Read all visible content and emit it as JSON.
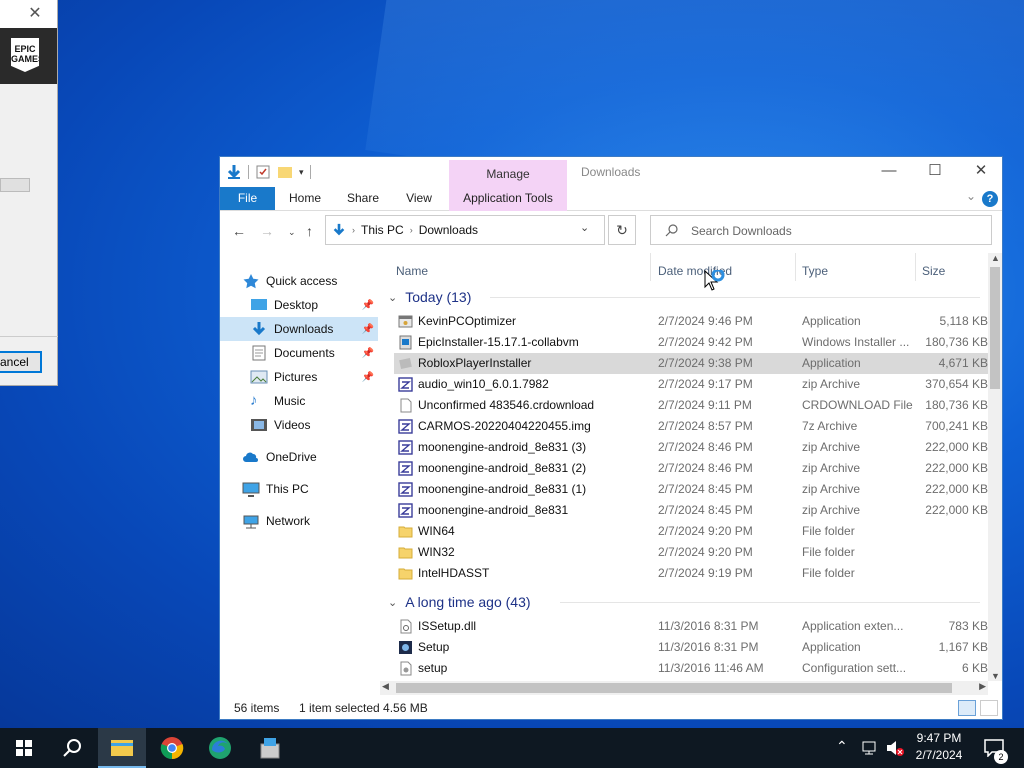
{
  "epic_dialog": {
    "cancel_label": "ancel",
    "logo_text": "EPIC\nGAMES"
  },
  "explorer": {
    "title": "Downloads",
    "context_tab": "Manage",
    "ribbon_tabs": [
      "File",
      "Home",
      "Share",
      "View",
      "Application Tools"
    ],
    "breadcrumb": [
      "This PC",
      "Downloads"
    ],
    "search_placeholder": "Search Downloads",
    "nav": [
      {
        "label": "Quick access",
        "icon": "star-icon"
      },
      {
        "label": "Desktop",
        "icon": "desktop-icon",
        "pinned": true
      },
      {
        "label": "Downloads",
        "icon": "downloads-icon",
        "pinned": true,
        "selected": true
      },
      {
        "label": "Documents",
        "icon": "documents-icon",
        "pinned": true
      },
      {
        "label": "Pictures",
        "icon": "pictures-icon",
        "pinned": true
      },
      {
        "label": "Music",
        "icon": "music-icon"
      },
      {
        "label": "Videos",
        "icon": "videos-icon"
      },
      {
        "label": "OneDrive",
        "icon": "cloud-icon"
      },
      {
        "label": "This PC",
        "icon": "computer-icon"
      },
      {
        "label": "Network",
        "icon": "network-icon"
      }
    ],
    "columns": [
      "Name",
      "Date modified",
      "Type",
      "Size"
    ],
    "groups": [
      {
        "label": "Today (13)",
        "files": [
          {
            "name": "KevinPCOptimizer",
            "date": "2/7/2024 9:46 PM",
            "type": "Application",
            "size": "5,118 KB",
            "icon": "app"
          },
          {
            "name": "EpicInstaller-15.17.1-collabvm",
            "date": "2/7/2024 9:42 PM",
            "type": "Windows Installer ...",
            "size": "180,736 KB",
            "icon": "msi"
          },
          {
            "name": "RobloxPlayerInstaller",
            "date": "2/7/2024 9:38 PM",
            "type": "Application",
            "size": "4,671 KB",
            "icon": "roblox",
            "selected": true
          },
          {
            "name": "audio_win10_6.0.1.7982",
            "date": "2/7/2024 9:17 PM",
            "type": "zip Archive",
            "size": "370,654 KB",
            "icon": "zip"
          },
          {
            "name": "Unconfirmed 483546.crdownload",
            "date": "2/7/2024 9:11 PM",
            "type": "CRDOWNLOAD File",
            "size": "180,736 KB",
            "icon": "blank"
          },
          {
            "name": "CARMOS-20220404220455.img",
            "date": "2/7/2024 8:57 PM",
            "type": "7z Archive",
            "size": "700,241 KB",
            "icon": "zip"
          },
          {
            "name": "moonengine-android_8e831 (3)",
            "date": "2/7/2024 8:46 PM",
            "type": "zip Archive",
            "size": "222,000 KB",
            "icon": "zip"
          },
          {
            "name": "moonengine-android_8e831 (2)",
            "date": "2/7/2024 8:46 PM",
            "type": "zip Archive",
            "size": "222,000 KB",
            "icon": "zip"
          },
          {
            "name": "moonengine-android_8e831 (1)",
            "date": "2/7/2024 8:45 PM",
            "type": "zip Archive",
            "size": "222,000 KB",
            "icon": "zip"
          },
          {
            "name": "moonengine-android_8e831",
            "date": "2/7/2024 8:45 PM",
            "type": "zip Archive",
            "size": "222,000 KB",
            "icon": "zip"
          },
          {
            "name": "WIN64",
            "date": "2/7/2024 9:20 PM",
            "type": "File folder",
            "size": "",
            "icon": "folder"
          },
          {
            "name": "WIN32",
            "date": "2/7/2024 9:20 PM",
            "type": "File folder",
            "size": "",
            "icon": "folder"
          },
          {
            "name": "IntelHDASST",
            "date": "2/7/2024 9:19 PM",
            "type": "File folder",
            "size": "",
            "icon": "folder"
          }
        ]
      },
      {
        "label": "A long time ago (43)",
        "files": [
          {
            "name": "ISSetup.dll",
            "date": "11/3/2016 8:31 PM",
            "type": "Application exten...",
            "size": "783 KB",
            "icon": "dll"
          },
          {
            "name": "Setup",
            "date": "11/3/2016 8:31 PM",
            "type": "Application",
            "size": "1,167 KB",
            "icon": "setup"
          },
          {
            "name": "setup",
            "date": "11/3/2016 11:46 AM",
            "type": "Configuration sett...",
            "size": "6 KB",
            "icon": "config"
          }
        ]
      }
    ],
    "status": {
      "items": "56 items",
      "selected": "1 item selected  4.56 MB"
    }
  },
  "taskbar": {
    "time": "9:47 PM",
    "date": "2/7/2024",
    "notification_count": "2",
    "apps": [
      "file-explorer-icon",
      "chrome-icon",
      "edge-icon",
      "installer-icon"
    ]
  },
  "colors": {
    "accent": "#1979ca",
    "selection": "#cce4f7",
    "contextual": "#f4d3f6"
  }
}
